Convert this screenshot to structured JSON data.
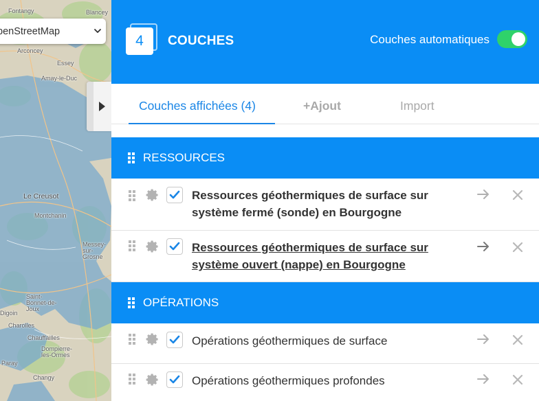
{
  "map": {
    "basemap_select": {
      "value": "penStreetMap"
    },
    "places": [
      {
        "name": "Fontangy",
        "big": false
      },
      {
        "name": "Blancey",
        "big": false
      },
      {
        "name": "Arconcey",
        "big": false
      },
      {
        "name": "Essey",
        "big": false
      },
      {
        "name": "Amay-le-Duc",
        "big": false
      },
      {
        "name": "Le Creusot",
        "big": true
      },
      {
        "name": "Montchanin",
        "big": false
      },
      {
        "name": "Messey-sur-Grosne",
        "big": false
      },
      {
        "name": "Saint-Bonnet-de-Joux",
        "big": false
      },
      {
        "name": "Charolles",
        "big": false
      },
      {
        "name": "Digoin",
        "big": false
      },
      {
        "name": "Chauffailles",
        "big": false
      },
      {
        "name": "Dompierre-les-Ormes",
        "big": false
      },
      {
        "name": "Changy",
        "big": false
      },
      {
        "name": "Paray",
        "big": false
      }
    ]
  },
  "panel": {
    "layer_count": "4",
    "title": "COUCHES",
    "auto_layers_label": "Couches automatiques",
    "auto_layers_enabled": true,
    "accent_color": "#0a8df5",
    "toggle_color": "#2fd26a",
    "tabs": [
      {
        "label": "Couches affichées (4)",
        "active": true
      },
      {
        "label": "+Ajout",
        "active": false
      },
      {
        "label": "Import",
        "active": false
      }
    ],
    "sections": [
      {
        "title": "RESSOURCES",
        "layers": [
          {
            "label": "Ressources géothermiques de surface sur système fermé (sonde) en Bourgogne",
            "checked": true,
            "bold": true,
            "underline": false
          },
          {
            "label": "Ressources géothermiques de surface sur système ouvert (nappe) en Bourgogne",
            "checked": true,
            "bold": true,
            "underline": true
          }
        ]
      },
      {
        "title": "OPÉRATIONS",
        "layers": [
          {
            "label": "Opérations géothermiques de surface",
            "checked": true,
            "bold": false,
            "underline": false
          },
          {
            "label": "Opérations géothermiques profondes",
            "checked": true,
            "bold": false,
            "underline": false
          }
        ]
      }
    ]
  }
}
